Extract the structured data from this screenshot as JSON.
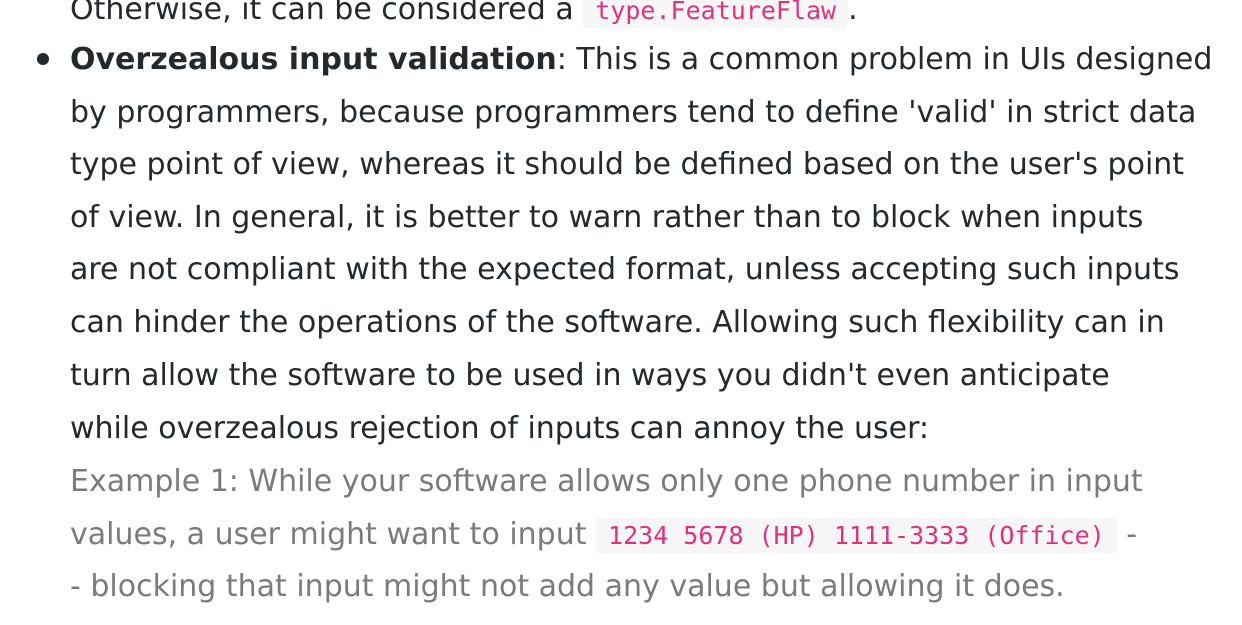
{
  "top_line": {
    "text": "Otherwise, it can be considered a ",
    "code": "type.FeatureFlaw",
    "suffix": "."
  },
  "item": {
    "term": "Overzealous input validation",
    "lines": [
      ": This is a common problem in UIs designed",
      "by programmers, because programmers tend to define 'valid' in strict data",
      "type point of view, whereas it should be defined based on the user's point",
      "of view. In general, it is better to warn rather than to block when inputs",
      "are not compliant with the expected format, unless accepting such inputs",
      "can hinder the operations of the software. Allowing such flexibility can in",
      "turn allow the software to be used in ways you didn't even anticipate",
      "while overzealous rejection of inputs can annoy the user:"
    ],
    "example": {
      "line1": "Example 1: While your software allows only one phone number in input",
      "line2_prefix": "values, a user might want to input ",
      "code": "1234 5678 (HP) 1111-3333 (Office)",
      "line2_suffix": " -",
      "line3": "- blocking that input might not add any value but allowing it does."
    }
  }
}
